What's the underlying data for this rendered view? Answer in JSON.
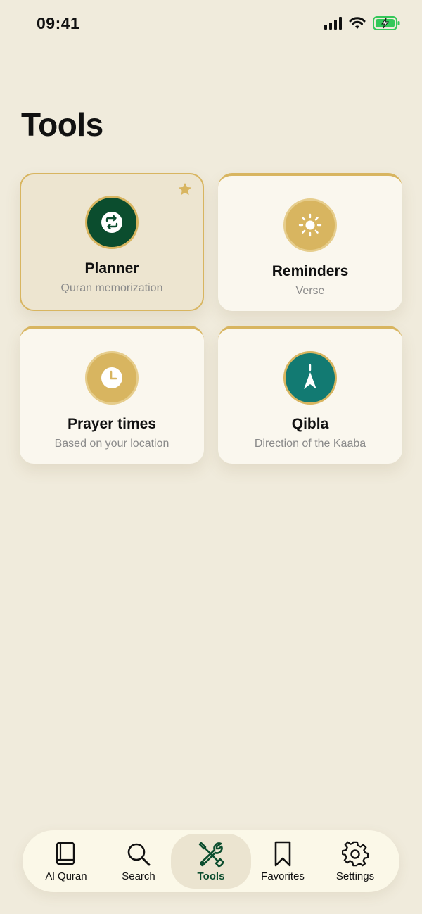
{
  "status_bar": {
    "time": "09:41"
  },
  "page": {
    "title": "Tools"
  },
  "cards": [
    {
      "title": "Planner",
      "subtitle": "Quran memorization",
      "icon": "repeat-icon",
      "icon_bg": "#0b4d2e",
      "selected": true
    },
    {
      "title": "Reminders",
      "subtitle": "Verse",
      "icon": "sun-icon",
      "icon_bg": "#d8b560",
      "selected": false
    },
    {
      "title": "Prayer times",
      "subtitle": "Based on your location",
      "icon": "clock-icon",
      "icon_bg": "#d8b560",
      "selected": false
    },
    {
      "title": "Qibla",
      "subtitle": "Direction of the Kaaba",
      "icon": "compass-arrow-icon",
      "icon_bg": "#127a72",
      "selected": false
    }
  ],
  "tabs": [
    {
      "label": "Al Quran",
      "icon": "book-icon",
      "active": false
    },
    {
      "label": "Search",
      "icon": "search-icon",
      "active": false
    },
    {
      "label": "Tools",
      "icon": "tools-icon",
      "active": true
    },
    {
      "label": "Favorites",
      "icon": "bookmark-icon",
      "active": false
    },
    {
      "label": "Settings",
      "icon": "gear-icon",
      "active": false
    }
  ],
  "colors": {
    "background": "#f0ebdc",
    "accent_gold": "#d8b560",
    "primary_green": "#0b4d2e",
    "teal": "#127a72",
    "battery_green": "#34c759"
  }
}
